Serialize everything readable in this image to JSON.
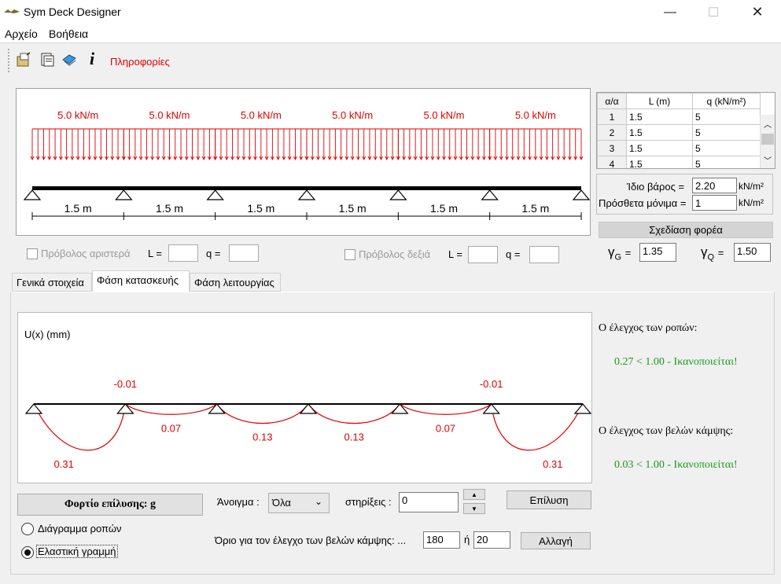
{
  "window": {
    "title": "Sym Deck Designer",
    "minimize": "—",
    "maximize": "☐",
    "close": "✕"
  },
  "menu": {
    "file": "Αρχείο",
    "help": "Βοήθεια"
  },
  "toolbar": {
    "info_label": "Πληροφορίες"
  },
  "load_diagram": {
    "loads": [
      "5.0 kN/m",
      "5.0 kN/m",
      "5.0 kN/m",
      "5.0 kN/m",
      "5.0 kN/m",
      "5.0 kN/m"
    ],
    "spans": [
      "1.5 m",
      "1.5 m",
      "1.5 m",
      "1.5 m",
      "1.5 m",
      "1.5 m"
    ]
  },
  "cantilever": {
    "left_label": "Πρόβολος αριστερά",
    "right_label": "Πρόβολος δεξιά",
    "l_label": "L =",
    "q_label": "q ="
  },
  "span_table": {
    "headers": [
      "α/α",
      "L (m)",
      "q (kN/m²)"
    ],
    "rows": [
      [
        "1",
        "1.5",
        "5"
      ],
      [
        "2",
        "1.5",
        "5"
      ],
      [
        "3",
        "1.5",
        "5"
      ],
      [
        "4",
        "1.5",
        "5"
      ]
    ]
  },
  "loads_panel": {
    "self_weight_label": "Ίδιο βάρος =",
    "self_weight_value": "2.20",
    "self_weight_unit": "kN/m²",
    "extra_label": "Πρόσθετα μόνιμα =",
    "extra_value": "1",
    "extra_unit": "kN/m²",
    "design_button": "Σχεδίαση φορέα",
    "gamma_g_symbol": "γ",
    "gamma_g_sub": "G",
    "gamma_g_value": "1.35",
    "gamma_q_symbol": "γ",
    "gamma_q_sub": "Q",
    "gamma_q_value": "1.50",
    "eq": "="
  },
  "tabs": [
    "Γενικά στοιχεία",
    "Φάση κατασκευής",
    "Φάση λειτουργίας"
  ],
  "active_tab": 1,
  "deflection": {
    "ylabel": "U(x) (mm)",
    "values": [
      0.31,
      0.07,
      0.13,
      0.13,
      0.07,
      0.31
    ],
    "value_labels": [
      "0.31",
      "0.07",
      "0.13",
      "0.13",
      "0.07",
      "0.31"
    ],
    "uplift_labels": [
      "-0.01",
      "-0.01"
    ]
  },
  "checks": {
    "moment_title": "Ο έλεγχος των ροπών:",
    "moment_result": "0.27 < 1.00 - Ικανοποιείται!",
    "deflection_title": "Ο έλεγχος των βελών κάμψης:",
    "deflection_result": "0.03 < 1.00 - Ικανοποιείται!"
  },
  "controls": {
    "load_case": "Φορτίο επίλυσης: g",
    "radio_moments": "Διάγραμμα ροπών",
    "radio_elastic": "Ελαστική γραμμή",
    "span_label": "Άνοιγμα :",
    "span_select": "Όλα",
    "supports_label": "στηρίξεις :",
    "supports_value": "0",
    "solve_button": "Επίλυση",
    "limit_label": "Όριο για τον έλεγχο των βελών κάμψης: ...",
    "limit_value1": "180",
    "or_label": "ή",
    "limit_value2": "20",
    "change_button": "Αλλαγή"
  },
  "colors": {
    "red": "#e00000",
    "green": "#1a9a1a",
    "beam": "#000000"
  }
}
